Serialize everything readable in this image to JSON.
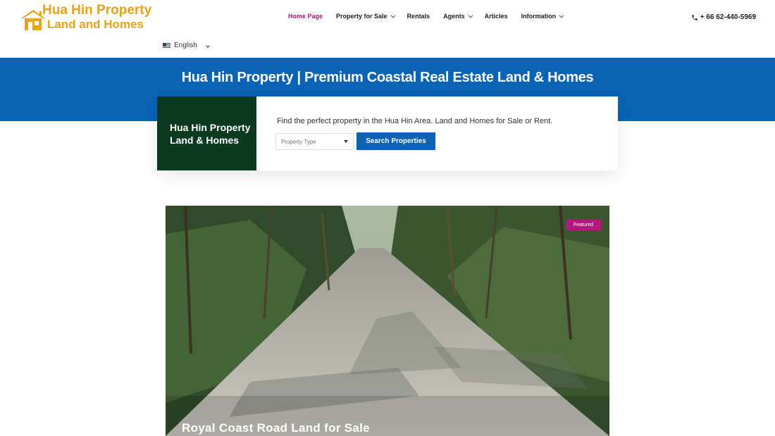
{
  "header": {
    "logo": {
      "line1": "Hua Hin Property",
      "line2": "Land and Homes"
    },
    "nav": [
      {
        "label": "Home Page",
        "active": true,
        "has_dropdown": false
      },
      {
        "label": "Property for Sale",
        "active": false,
        "has_dropdown": true
      },
      {
        "label": "Rentals",
        "active": false,
        "has_dropdown": false
      },
      {
        "label": "Agents",
        "active": false,
        "has_dropdown": true
      },
      {
        "label": "Articles",
        "active": false,
        "has_dropdown": false
      },
      {
        "label": "Information",
        "active": false,
        "has_dropdown": true
      }
    ],
    "phone": "+ 66 62-440-5969",
    "phone_icon": "phone-icon",
    "language": {
      "selected": "English",
      "flag_icon": "us-flag-icon"
    }
  },
  "banner": {
    "title": "Hua Hin Property | Premium Coastal Real Estate Land & Homes"
  },
  "search": {
    "side_title_line1": "Hua Hin Property",
    "side_title_line2": "Land & Homes",
    "description": "Find the perfect property in the Hua Hin Area. Land and Homes for Sale or Rent.",
    "type_placeholder": "Property Type",
    "button_label": "Search Properties"
  },
  "featured_listing": {
    "badge": "Featured",
    "title": "Royal Coast Road Land for Sale"
  },
  "colors": {
    "brand_blue": "#0a63b4",
    "accent_magenta": "#b5177f",
    "logo_orange": "#e8a21c",
    "dark_green": "#0b3a20"
  }
}
